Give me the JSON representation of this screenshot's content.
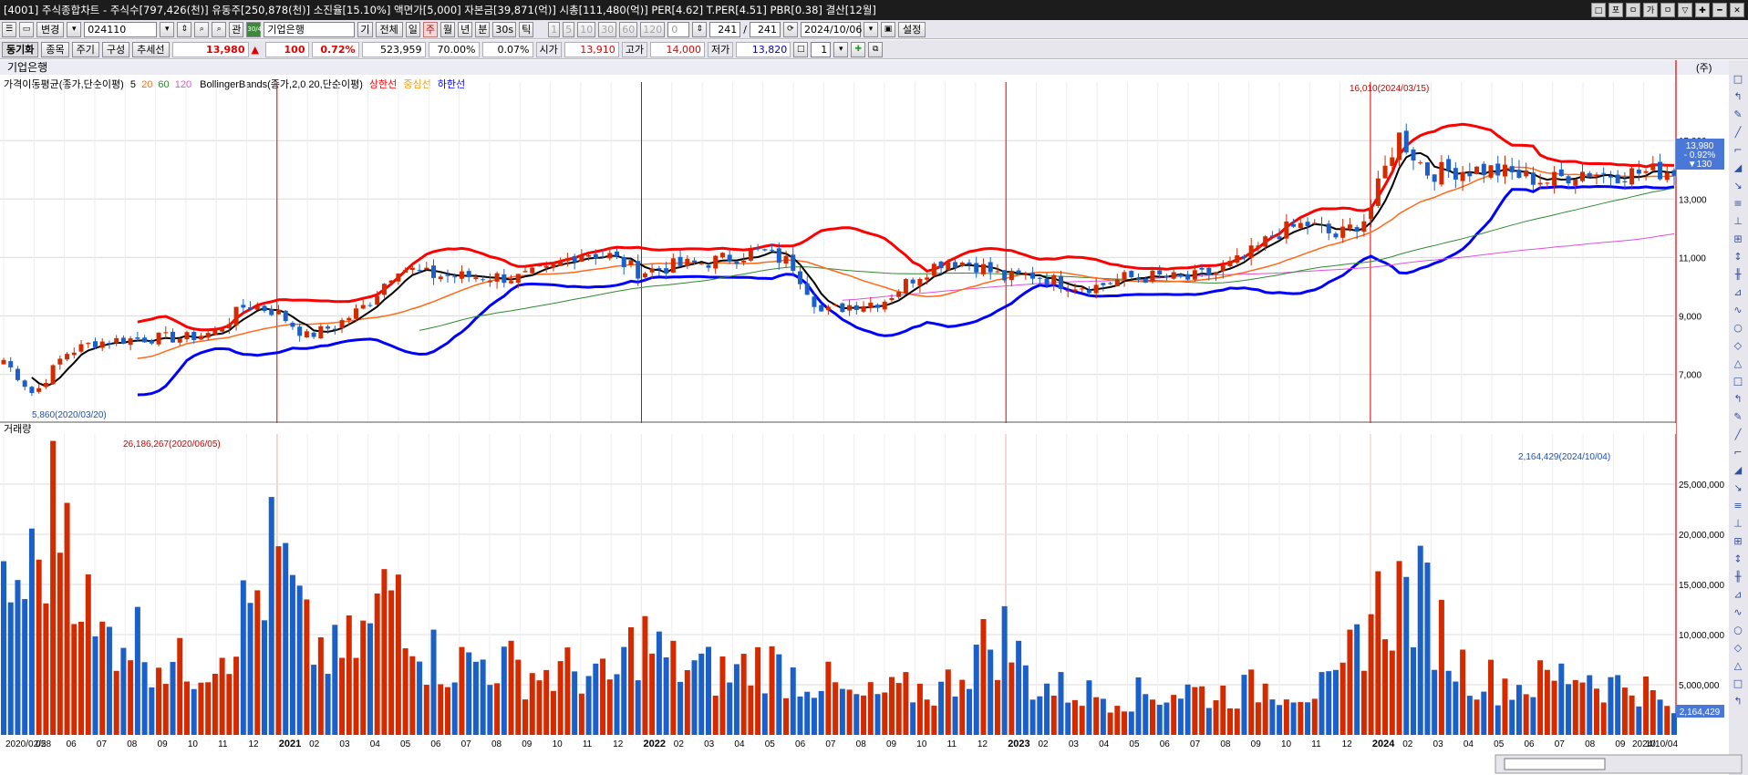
{
  "title": "[4001] 주식종합차트 - 주식수[797,426(천)] 유동주[250,878(천)] 소진율[15.10%] 액면가[5,000] 자본금[39,871(억)] 시총[111,480(억)] PER[4.62] T.PER[4.51] PBR[0.38] 결산[12월]",
  "window_buttons": [
    "□",
    "포",
    "ㅁ",
    "가",
    "ㅁ",
    "▽",
    "✚",
    "━",
    "✕"
  ],
  "toolbar1": {
    "change_label": "변경",
    "code": "024110",
    "gwan": "관",
    "gwan_icon": "30/45",
    "stock_name": "기업은행",
    "ga": "기",
    "all": "전체",
    "periods": [
      "일",
      "주",
      "월",
      "년",
      "분",
      "30s",
      "틱"
    ],
    "selected_period": "주",
    "tick_options": [
      "1",
      "5",
      "10",
      "30",
      "60",
      "120"
    ],
    "zero": "0",
    "count_a": "241",
    "slash": "/",
    "count_b": "241",
    "date": "2024/10/06",
    "settings": "설정"
  },
  "toolbar2": {
    "sync": "동기화",
    "item": "종목",
    "cycle": "주기",
    "config": "구성",
    "trendline": "추세선",
    "price": "13,980",
    "change_arrow": "▲",
    "change": "100",
    "change_pct": "0.72%",
    "volume": "523,959",
    "ratio": "70.00%",
    "ratio2": "0.07%",
    "open_label": "시가",
    "open": "13,910",
    "high_label": "고가",
    "high": "14,000",
    "low_label": "저가",
    "low": "13,820",
    "spin_val": "1"
  },
  "chart_data": {
    "type": "candlestick",
    "title": "기업은행",
    "unit_label": "(주)",
    "price_legend": {
      "ma_label": "가격이동평균(종가,단순이평)",
      "ma_periods": [
        "5",
        "20",
        "60",
        "120"
      ],
      "bb_label": "BollingerBands(종가,2,0,20,단순이평)",
      "bb_upper": "상한선",
      "bb_mid": "중심선",
      "bb_lower": "하한선"
    },
    "y_ticks": [
      15000,
      13000,
      11000,
      9000,
      7000
    ],
    "y_tick_labels": [
      "15,000",
      "13,000",
      "11,000",
      "9,000",
      "7,000"
    ],
    "y_range": [
      5400,
      17000
    ],
    "max_annotation": "16,010(2024/03/15)",
    "min_annotation": "5,860(2020/03/20)",
    "current_price_box": [
      "13,980",
      "- 0.92%",
      "▼130"
    ],
    "volume_title": "거래량",
    "volume_max_annotation": "26,186,267(2020/06/05)",
    "volume_last_annotation": "2,164,429(2024/10/04)",
    "volume_last_box": "2,164,429",
    "volume_ticks": [
      25000000,
      20000000,
      15000000,
      10000000,
      5000000
    ],
    "volume_tick_labels": [
      "25,000,000",
      "20,000,000",
      "15,000,000",
      "10,000,000",
      "5,000,000"
    ],
    "volume_range": [
      0,
      30000000
    ],
    "x_labels": [
      "2020/02/28",
      "05",
      "06",
      "07",
      "08",
      "09",
      "10",
      "11",
      "12",
      "2021",
      "02",
      "03",
      "04",
      "05",
      "06",
      "07",
      "08",
      "09",
      "10",
      "11",
      "12",
      "2022",
      "02",
      "03",
      "04",
      "05",
      "06",
      "07",
      "08",
      "09",
      "10",
      "11",
      "12",
      "2023",
      "02",
      "03",
      "04",
      "05",
      "06",
      "07",
      "08",
      "09",
      "10",
      "11",
      "12",
      "2024",
      "02",
      "03",
      "04",
      "05",
      "06",
      "07",
      "08",
      "09",
      "10",
      "2024/10/04"
    ],
    "year_marks": [
      "2021",
      "2022",
      "2023",
      "2024"
    ],
    "monthly_close": [
      7500,
      6300,
      7700,
      8100,
      8200,
      8250,
      8250,
      8450,
      9400,
      9150,
      8300,
      8700,
      9400,
      10700,
      10400,
      10350,
      10350,
      10300,
      10550,
      11200,
      11050,
      10500,
      10700,
      10800,
      11000,
      11200,
      10800,
      9100,
      9400,
      9500,
      10300,
      10900,
      10800,
      10300,
      10400,
      10100,
      10000,
      10300,
      10350,
      10250,
      10500,
      11000,
      11850,
      12150,
      11700,
      12400,
      15200,
      13900,
      14000,
      14000,
      13800,
      13600,
      13950,
      13850,
      13900,
      13980
    ],
    "volume_monthly": [
      14000000,
      16000000,
      25000000,
      9000000,
      11000000,
      8000000,
      6500000,
      8500000,
      12000000,
      18000000,
      9500000,
      7500000,
      10000000,
      16000000,
      8000000,
      7000000,
      7500000,
      6500000,
      6000000,
      6500000,
      5000000,
      10000000,
      7000000,
      6500000,
      6000000,
      7500000,
      6000000,
      5500000,
      3500000,
      4000000,
      4500000,
      4500000,
      8000000,
      10000000,
      5000000,
      4500000,
      4000000,
      4000000,
      4000000,
      4500000,
      4000000,
      4500000,
      5000000,
      4500000,
      4500000,
      12000000,
      14000000,
      13000000,
      7000000,
      5500000,
      5000000,
      5500000,
      6500000,
      5000000,
      5000000,
      2164429
    ],
    "colors": {
      "up": "#d42a00",
      "down": "#1b60c8",
      "ma5": "#000000",
      "ma20": "#ff6a1a",
      "ma60": "#2f8a2f",
      "ma120": "#e050e0",
      "bb_upper": "#ff0000",
      "bb_mid": "#ff9900",
      "bb_lower": "#0000ff",
      "year_line": "#e00000"
    }
  }
}
